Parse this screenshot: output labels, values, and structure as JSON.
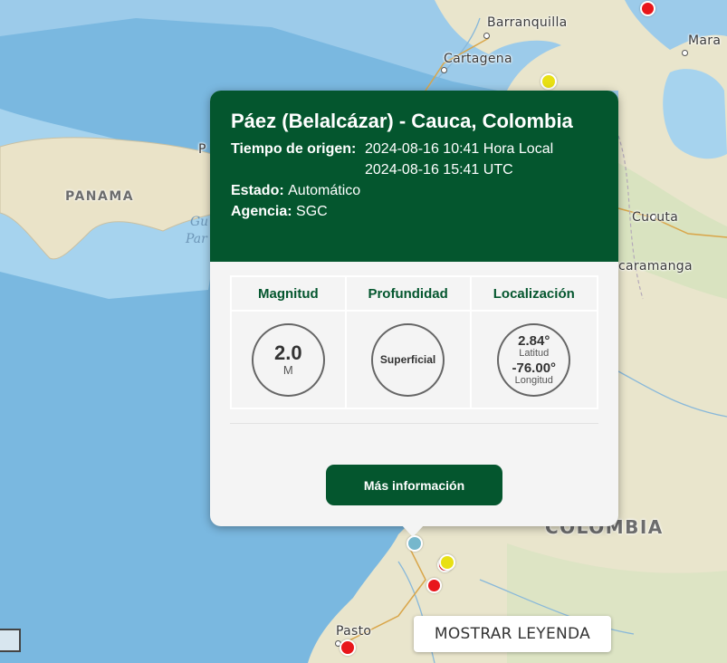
{
  "map": {
    "cities": [
      {
        "name": "Barranquilla",
        "cls": "bq"
      },
      {
        "name": "Cartagena",
        "cls": "ct"
      },
      {
        "name": "Mara",
        "cls": "mr"
      },
      {
        "name": "Cucuta",
        "cls": "cu"
      },
      {
        "name": "caramanga",
        "cls": "bu"
      },
      {
        "name": "P",
        "cls": "pa"
      },
      {
        "name": "Pasto",
        "cls": "ps"
      }
    ],
    "countries": {
      "panama": "PANAMA",
      "colombia": "COLOMBIA"
    },
    "water": {
      "line1": "Gu",
      "line2": "Par"
    },
    "quake_colors": {
      "red": "#e8161b",
      "yellow": "#e8e014",
      "selected": "#76b7cc"
    }
  },
  "popup": {
    "title": "Páez (Belalcázar) - Cauca, Colombia",
    "origin_label": "Tiempo de origen:",
    "origin_local": "2024-08-16 10:41 Hora Local",
    "origin_utc": "2024-08-16 15:41 UTC",
    "status_label": "Estado:",
    "status_value": "Automático",
    "agency_label": "Agencia:",
    "agency_value": "SGC",
    "columns": {
      "magnitude": "Magnitud",
      "depth": "Profundidad",
      "location": "Localización"
    },
    "magnitude": {
      "value": "2.0",
      "unit": "M"
    },
    "depth": {
      "value": "Superficial"
    },
    "location": {
      "lat": "2.84°",
      "lat_label": "Latitud",
      "lon": "-76.00°",
      "lon_label": "Longitud"
    },
    "more_button": "Más información"
  },
  "legend_button": "MOSTRAR LEYENDA",
  "colors": {
    "header_green": "#04562e",
    "popup_bg": "#f4f4f4"
  }
}
